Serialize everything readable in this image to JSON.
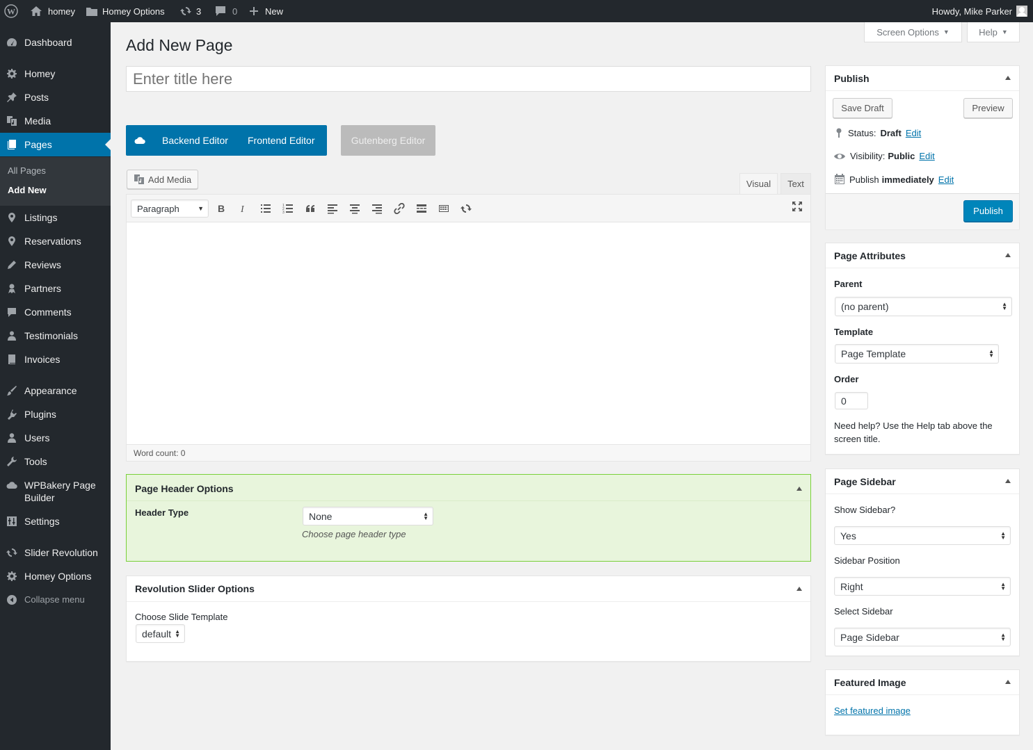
{
  "adminbar": {
    "site_name": "homey",
    "options_label": "Homey Options",
    "updates_count": "3",
    "comments_count": "0",
    "new_label": "New",
    "howdy": "Howdy, Mike Parker"
  },
  "sidebar": {
    "items": [
      {
        "label": "Dashboard",
        "icon": "dashboard-icon"
      },
      {
        "label": "Homey",
        "icon": "gear-icon"
      },
      {
        "label": "Posts",
        "icon": "pin-icon"
      },
      {
        "label": "Media",
        "icon": "media-icon"
      },
      {
        "label": "Pages",
        "icon": "pages-icon"
      },
      {
        "label": "Listings",
        "icon": "location-icon"
      },
      {
        "label": "Reservations",
        "icon": "location-icon"
      },
      {
        "label": "Reviews",
        "icon": "pencil-icon"
      },
      {
        "label": "Partners",
        "icon": "partners-icon"
      },
      {
        "label": "Comments",
        "icon": "comment-icon"
      },
      {
        "label": "Testimonials",
        "icon": "user-icon"
      },
      {
        "label": "Invoices",
        "icon": "book-icon"
      },
      {
        "label": "Appearance",
        "icon": "brush-icon"
      },
      {
        "label": "Plugins",
        "icon": "plugin-icon"
      },
      {
        "label": "Users",
        "icon": "users-icon"
      },
      {
        "label": "Tools",
        "icon": "wrench-icon"
      },
      {
        "label": "WPBakery Page Builder",
        "icon": "cloud-icon"
      },
      {
        "label": "Settings",
        "icon": "settings-icon"
      },
      {
        "label": "Slider Revolution",
        "icon": "refresh-icon"
      },
      {
        "label": "Homey Options",
        "icon": "gear-icon"
      },
      {
        "label": "Collapse menu",
        "icon": "collapse-icon"
      }
    ],
    "submenu": {
      "all_pages": "All Pages",
      "add_new": "Add New"
    }
  },
  "top_buttons": {
    "screen_options": "Screen Options",
    "help": "Help"
  },
  "page_title": "Add New Page",
  "title_placeholder": "Enter title here",
  "builder": {
    "backend": "Backend Editor",
    "frontend": "Frontend Editor",
    "gutenberg": "Gutenberg Editor"
  },
  "editor": {
    "add_media": "Add Media",
    "tab_visual": "Visual",
    "tab_text": "Text",
    "format": "Paragraph",
    "word_count": "Word count: 0"
  },
  "header_options": {
    "title": "Page Header Options",
    "label": "Header Type",
    "value": "None",
    "hint": "Choose page header type"
  },
  "rev_slider": {
    "title": "Revolution Slider Options",
    "label": "Choose Slide Template",
    "value": "default"
  },
  "publish": {
    "title": "Publish",
    "save_draft": "Save Draft",
    "preview": "Preview",
    "status_label": "Status:",
    "status_value": "Draft",
    "visibility_label": "Visibility:",
    "visibility_value": "Public",
    "publish_label": "Publish",
    "publish_value": "immediately",
    "edit": "Edit",
    "publish_button": "Publish"
  },
  "page_attributes": {
    "title": "Page Attributes",
    "parent_label": "Parent",
    "parent_value": "(no parent)",
    "template_label": "Template",
    "template_value": "Page Template",
    "order_label": "Order",
    "order_value": "0",
    "help_text": "Need help? Use the Help tab above the screen title."
  },
  "page_sidebar": {
    "title": "Page Sidebar",
    "show_label": "Show Sidebar?",
    "show_value": "Yes",
    "position_label": "Sidebar Position",
    "position_value": "Right",
    "select_label": "Select Sidebar",
    "select_value": "Page Sidebar"
  },
  "featured_image": {
    "title": "Featured Image",
    "link": "Set featured image"
  },
  "colors": {
    "accent": "#0073aa",
    "adminbar": "#23282d",
    "header_options_bg": "#e8f5dc",
    "header_options_border": "#7ad03a"
  }
}
